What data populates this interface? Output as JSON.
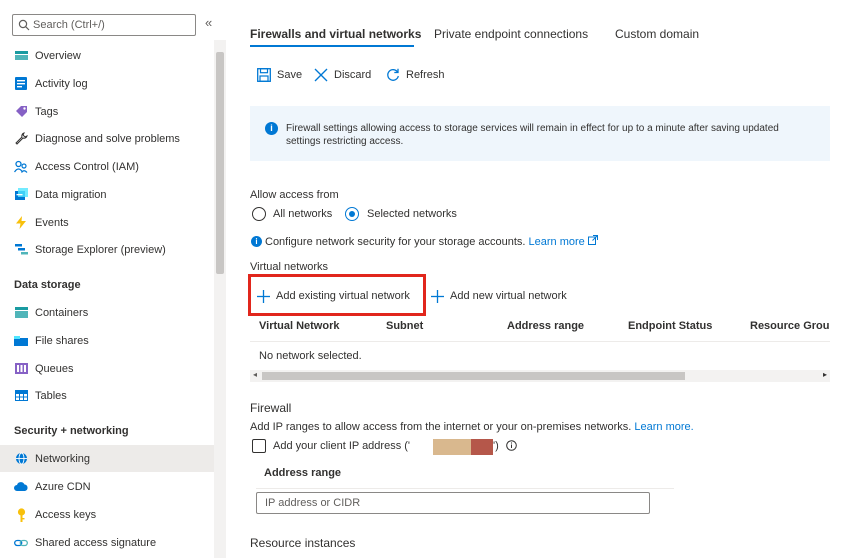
{
  "sidebar": {
    "search_placeholder": "Search (Ctrl+/)",
    "collapse_glyph": "«",
    "items_top": [
      {
        "label": "Overview",
        "icon": "overview-icon"
      },
      {
        "label": "Activity log",
        "icon": "activity-log-icon"
      },
      {
        "label": "Tags",
        "icon": "tag-icon"
      },
      {
        "label": "Diagnose and solve problems",
        "icon": "wrench-icon"
      },
      {
        "label": "Access Control (IAM)",
        "icon": "people-icon"
      },
      {
        "label": "Data migration",
        "icon": "data-migration-icon"
      },
      {
        "label": "Events",
        "icon": "lightning-icon"
      },
      {
        "label": "Storage Explorer (preview)",
        "icon": "storage-explorer-icon"
      }
    ],
    "section_data_storage": "Data storage",
    "items_data": [
      {
        "label": "Containers",
        "icon": "containers-icon"
      },
      {
        "label": "File shares",
        "icon": "file-shares-icon"
      },
      {
        "label": "Queues",
        "icon": "queues-icon"
      },
      {
        "label": "Tables",
        "icon": "tables-icon"
      }
    ],
    "section_security": "Security + networking",
    "items_security": [
      {
        "label": "Networking",
        "icon": "networking-icon",
        "active": true
      },
      {
        "label": "Azure CDN",
        "icon": "cloud-icon"
      },
      {
        "label": "Access keys",
        "icon": "key-icon"
      },
      {
        "label": "Shared access signature",
        "icon": "link-icon"
      }
    ]
  },
  "tabs": [
    {
      "label": "Firewalls and virtual networks",
      "active": true
    },
    {
      "label": "Private endpoint connections"
    },
    {
      "label": "Custom domain"
    }
  ],
  "toolbar": {
    "save_label": "Save",
    "discard_label": "Discard",
    "refresh_label": "Refresh"
  },
  "info_banner": "Firewall settings allowing access to storage services will remain in effect for up to a minute after saving updated settings restricting access.",
  "allow_access": {
    "label": "Allow access from",
    "option_all": "All networks",
    "option_selected": "Selected networks",
    "selected": "Selected networks"
  },
  "configure_note": {
    "text": "Configure network security for your storage accounts.",
    "link": "Learn more"
  },
  "vnet": {
    "heading": "Virtual networks",
    "add_existing": "Add existing virtual network",
    "add_new": "Add new virtual network",
    "columns": [
      "Virtual Network",
      "Subnet",
      "Address range",
      "Endpoint Status",
      "Resource Group"
    ],
    "empty_text": "No network selected."
  },
  "firewall": {
    "heading": "Firewall",
    "desc": "Add IP ranges to allow access from the internet or your on-premises networks.",
    "desc_link": "Learn more.",
    "client_ip_label": "Add your client IP address ('",
    "client_ip_suffix": "')",
    "address_range_header": "Address range",
    "ip_placeholder": "IP address or CIDR"
  },
  "resource_instances_heading": "Resource instances",
  "colors": {
    "accent": "#0078d4",
    "highlight_box": "#e1261c",
    "info_bg": "#eff6fc"
  }
}
